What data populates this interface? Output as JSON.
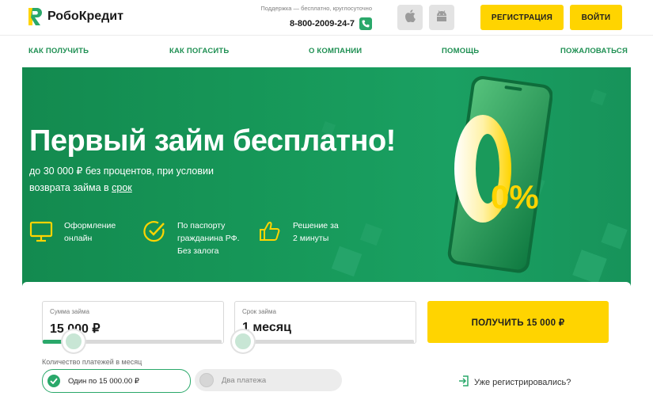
{
  "header": {
    "brand": "РобоКредит",
    "support_text": "Поддержка — бесплатно, круглосуточно",
    "phone": "8-800-2009-24-7",
    "register_label": "РЕГИСТРАЦИЯ",
    "login_label": "ВОЙТИ"
  },
  "nav": {
    "items": [
      {
        "label": "КАК ПОЛУЧИТЬ"
      },
      {
        "label": "КАК ПОГАСИТЬ"
      },
      {
        "label": "О КОМПАНИИ"
      },
      {
        "label": "ПОМОЩЬ"
      },
      {
        "label": "ПОЖАЛОВАТЬСЯ"
      }
    ]
  },
  "hero": {
    "title": "Первый займ бесплатно!",
    "subtitle_main": "до 30 000 ₽ без процентов, при условии возврата займа в ",
    "subtitle_link": "срок",
    "badge": "0%",
    "features": [
      {
        "line1": "Оформление",
        "line2": "онлайн",
        "line3": "",
        "icon": "monitor-icon"
      },
      {
        "line1": "По паспорту",
        "line2": "гражданина РФ.",
        "line3": "Без залога",
        "icon": "check-circle-icon"
      },
      {
        "line1": "Решение за",
        "line2": "2 минуты",
        "line3": "",
        "icon": "thumbs-up-icon"
      }
    ]
  },
  "calculator": {
    "amount_label": "Сумма займа",
    "amount_value": "15 000 ₽",
    "amount_slider_fraction": 0.14,
    "term_label": "Срок займа",
    "term_value": "1 месяц",
    "term_slider_fraction": 0.0,
    "get_button_label": "ПОЛУЧИТЬ 15 000 ₽",
    "payments_label": "Количество платежей в месяц",
    "payment_options": [
      {
        "label": "Один по 15 000.00 ₽",
        "selected": true
      },
      {
        "label": "Два платежа",
        "selected": false
      }
    ],
    "registered_link": "Уже регистрировались?"
  },
  "colors": {
    "accent_green": "#2aa86a",
    "hero_green": "#17995a",
    "button_yellow": "#ffd400",
    "nav_text": "#1e8f52"
  }
}
